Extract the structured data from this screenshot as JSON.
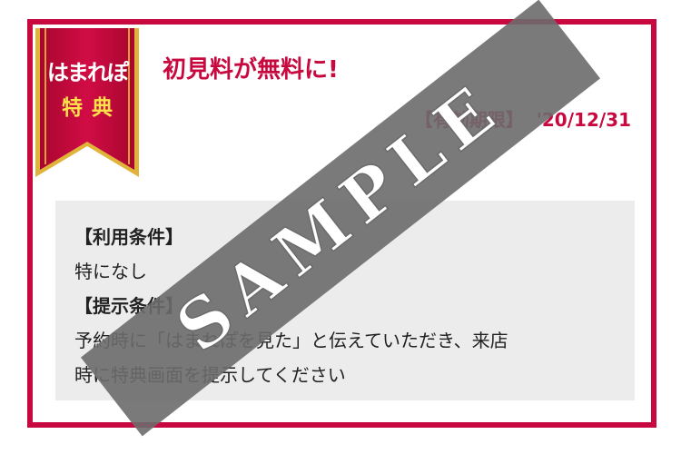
{
  "coupon": {
    "badge": {
      "brand": "はまれぽ",
      "label": "特典"
    },
    "title": "初見料が無料に!",
    "expiry": {
      "label": "【有効期限】",
      "date": "'20/12/31"
    },
    "conditions": {
      "usage_heading": "【利用条件】",
      "usage_text": "特になし",
      "presentation_heading": "【提示条件】",
      "presentation_text_line1": "予約時に「はまれぽを見た」と伝えていただき、来店",
      "presentation_text_line2": "時に特典画面を提示してください"
    }
  },
  "watermark": {
    "text": "SAMPLE"
  },
  "colors": {
    "accent": "#c8093f",
    "ribbon_gold": "#e0b43a",
    "badge_label": "#ffe14a",
    "conditions_bg": "#ececec",
    "watermark_band": "#6b6b6b"
  }
}
